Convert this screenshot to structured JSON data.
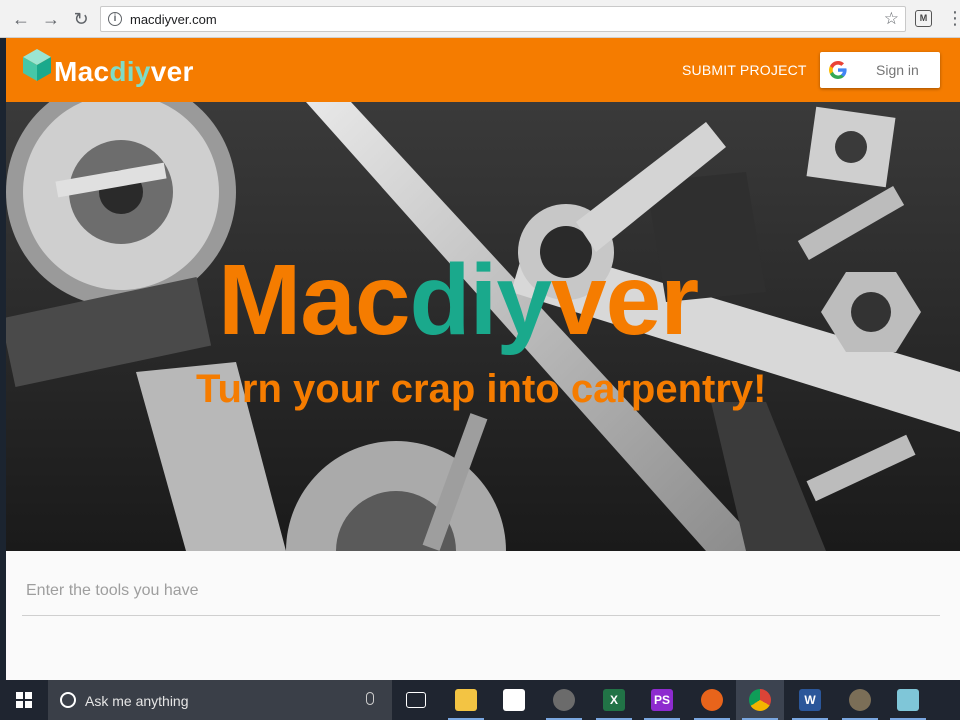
{
  "browser": {
    "url": "macdiyver.com",
    "extension_label": "M"
  },
  "appbar": {
    "logo_part1": "Mac",
    "logo_part2": "diy",
    "logo_part3": "ver",
    "submit_label": "SUBMIT PROJECT",
    "signin_label": "Sign in"
  },
  "hero": {
    "title_part1": "Mac",
    "title_part2": "diy",
    "title_part3": "ver",
    "subtitle": "Turn your crap into carpentry!"
  },
  "tools_input": {
    "placeholder": "Enter the tools you have",
    "value": ""
  },
  "taskbar": {
    "search_placeholder": "Ask me anything",
    "apps": [
      {
        "name": "task-view",
        "label": ""
      },
      {
        "name": "file-explorer",
        "label": ""
      },
      {
        "name": "store",
        "label": ""
      },
      {
        "name": "media-player",
        "label": ""
      },
      {
        "name": "excel",
        "label": "X"
      },
      {
        "name": "phpstorm",
        "label": "PS"
      },
      {
        "name": "firefox",
        "label": ""
      },
      {
        "name": "chrome",
        "label": ""
      },
      {
        "name": "word",
        "label": "W"
      },
      {
        "name": "gimp",
        "label": ""
      },
      {
        "name": "app-extra",
        "label": ""
      }
    ]
  },
  "colors": {
    "brand_orange": "#f57c00",
    "brand_teal": "#1aa98c",
    "logo_teal": "#7fdcc7",
    "taskbar": "#1f2530"
  }
}
